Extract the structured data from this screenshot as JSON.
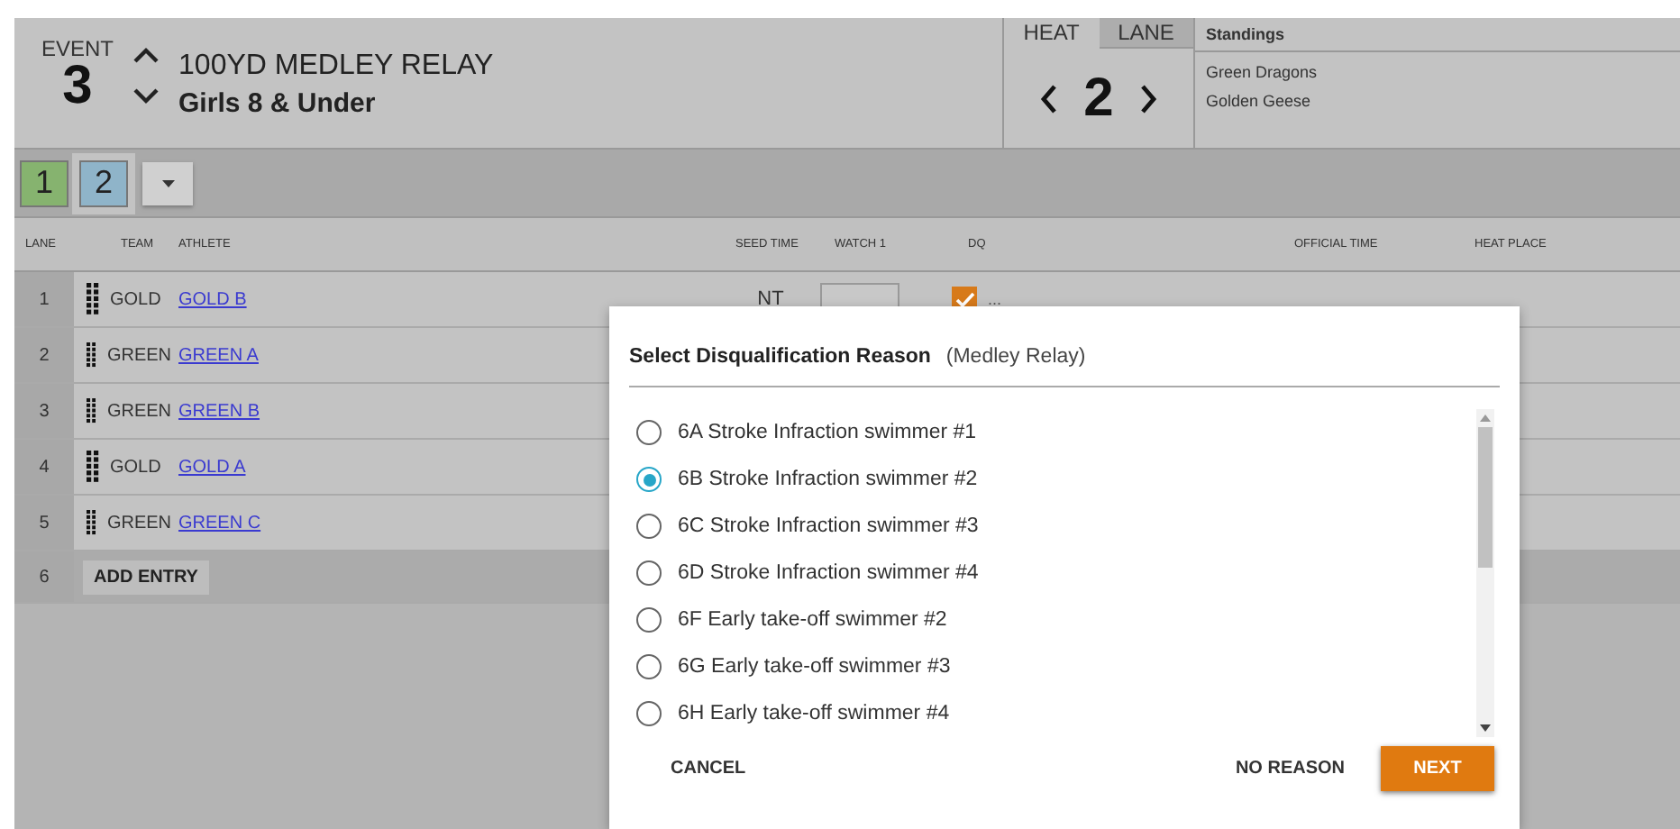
{
  "event": {
    "label": "EVENT",
    "number": "3",
    "name": "100YD MEDLEY RELAY",
    "group": "Girls 8 & Under"
  },
  "heat_panel": {
    "tabs": [
      {
        "label": "HEAT",
        "selected": true
      },
      {
        "label": "LANE",
        "selected": false
      }
    ],
    "number": "2"
  },
  "standings": {
    "title": "Standings",
    "teams": [
      "Green Dragons",
      "Golden Geese"
    ]
  },
  "heat_tabs": [
    {
      "label": "1",
      "selected": false,
      "color": "#86b36f"
    },
    {
      "label": "2",
      "selected": true,
      "color": "#8fb4c9"
    }
  ],
  "table": {
    "columns": [
      "LANE",
      "TEAM",
      "ATHLETE",
      "SEED TIME",
      "WATCH 1",
      "DQ",
      "OFFICIAL TIME",
      "HEAT PLACE"
    ],
    "rows": [
      {
        "lane": "1",
        "team": "GOLD",
        "athlete": "GOLD B",
        "seed_time": "NT",
        "dq_checked": true,
        "dq_more": "..."
      },
      {
        "lane": "2",
        "team": "GREEN",
        "athlete": "GREEN A"
      },
      {
        "lane": "3",
        "team": "GREEN",
        "athlete": "GREEN B"
      },
      {
        "lane": "4",
        "team": "GOLD",
        "athlete": "GOLD A"
      },
      {
        "lane": "5",
        "team": "GREEN",
        "athlete": "GREEN C"
      }
    ],
    "add_row": {
      "lane": "6",
      "label": "ADD ENTRY"
    }
  },
  "dialog": {
    "title": "Select Disqualification Reason",
    "subtitle": "(Medley Relay)",
    "reasons": [
      {
        "label": "6A Stroke Infraction swimmer #1",
        "selected": false
      },
      {
        "label": "6B Stroke Infraction swimmer #2",
        "selected": true
      },
      {
        "label": "6C Stroke Infraction swimmer #3",
        "selected": false
      },
      {
        "label": "6D Stroke Infraction swimmer #4",
        "selected": false
      },
      {
        "label": "6F Early take-off swimmer #2",
        "selected": false
      },
      {
        "label": "6G Early take-off swimmer #3",
        "selected": false
      },
      {
        "label": "6H Early take-off swimmer #4",
        "selected": false
      }
    ],
    "cancel": "CANCEL",
    "no_reason": "NO REASON",
    "next": "NEXT"
  }
}
